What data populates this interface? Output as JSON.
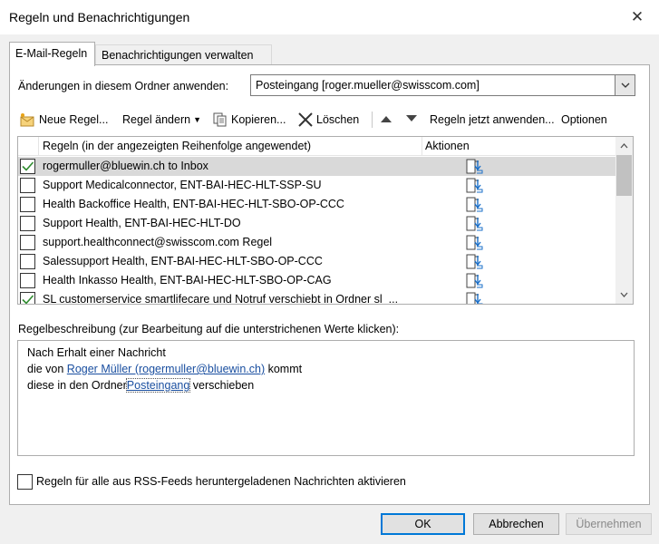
{
  "window": {
    "title": "Regeln und Benachrichtigungen"
  },
  "tabs": [
    {
      "label": "E-Mail-Regeln",
      "active": true
    },
    {
      "label": "Benachrichtigungen verwalten",
      "active": false
    }
  ],
  "folder": {
    "label": "Änderungen in diesem Ordner anwenden:",
    "value": "Posteingang [roger.mueller@swisscom.com]"
  },
  "toolbar": {
    "new_rule": "Neue Regel...",
    "change_rule": "Regel ändern",
    "copy": "Kopieren...",
    "delete": "Löschen",
    "run_now": "Regeln jetzt anwenden...",
    "options": "Optionen"
  },
  "rules_list": {
    "columns": [
      "Regeln (in der angezeigten Reihenfolge angewendet)",
      "Aktionen"
    ],
    "rows": [
      {
        "name": "rogermuller@bluewin.ch to Inbox",
        "checked": true,
        "selected": true
      },
      {
        "name": "Support Medicalconnector, ENT-BAI-HEC-HLT-SSP-SU",
        "checked": false,
        "selected": false
      },
      {
        "name": "Health Backoffice Health, ENT-BAI-HEC-HLT-SBO-OP-CCC",
        "checked": false,
        "selected": false
      },
      {
        "name": "Support Health, ENT-BAI-HEC-HLT-DO",
        "checked": false,
        "selected": false
      },
      {
        "name": "support.healthconnect@swisscom.com Regel",
        "checked": false,
        "selected": false
      },
      {
        "name": "Salessupport Health, ENT-BAI-HEC-HLT-SBO-OP-CCC",
        "checked": false,
        "selected": false
      },
      {
        "name": "Health Inkasso Health, ENT-BAI-HEC-HLT-SBO-OP-CAG",
        "checked": false,
        "selected": false
      },
      {
        "name": "SL customerservice smartlifecare und Notruf verschiebt in Ordner sl_...",
        "checked": true,
        "selected": false
      }
    ]
  },
  "description": {
    "label": "Regelbeschreibung (zur Bearbeitung auf die unterstrichenen Werte klicken):",
    "line1": "Nach Erhalt einer Nachricht",
    "line2_prefix": "die von",
    "line2_link": "Roger Müller (rogermuller@bluewin.ch)",
    "line2_suffix": "kommt",
    "line3_prefix": "diese in den Ordner",
    "line3_link": "Posteingang",
    "line3_suffix": "verschieben"
  },
  "rss": {
    "label": "Regeln für alle aus RSS-Feeds heruntergeladenen Nachrichten aktivieren",
    "checked": false
  },
  "buttons": {
    "ok": "OK",
    "cancel": "Abbrechen",
    "apply": "Übernehmen"
  },
  "colors": {
    "accent": "#0078d7",
    "link": "#1a4fa0",
    "check": "#2e8b2e"
  }
}
